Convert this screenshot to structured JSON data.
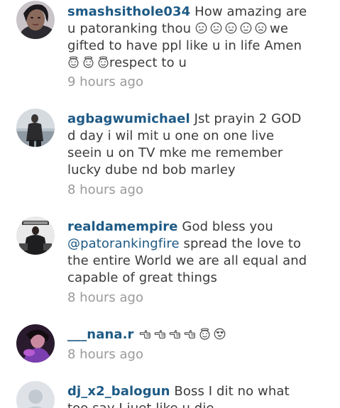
{
  "comments": [
    {
      "username": "smashsithole034",
      "text_1": "How amazing are u patoranking thou",
      "text_2": "we gifted to have ppl like u in life Amen",
      "text_3": "respect to u",
      "time": "9 hours ago"
    },
    {
      "username": "agbagwumichael",
      "text": "Jst prayin 2 GOD d day i wil mit u one on one live seein u on TV mke me remember lucky dube nd bob marley",
      "time": "8 hours ago"
    },
    {
      "username": "realdamempire",
      "text_1": "God bless you",
      "mention": "@patorankingfire",
      "text_2": "spread the love to the entire World we are all equal and capable of great things",
      "time": "8 hours ago"
    },
    {
      "username": "___nana.r",
      "time": "8 hours ago"
    },
    {
      "username": "dj_x2_balogun",
      "text": "Boss I dit no what  too say I juet like u die",
      "time": ""
    }
  ],
  "icons": {
    "unamused": "unamused-face-icon",
    "expressionless": "expressionless-face-icon",
    "neutral": "neutral-face-icon",
    "confused": "confused-face-icon",
    "angel": "smiling-face-with-halo-icon",
    "point_left": "backhand-index-pointing-left-icon",
    "heart_eyes": "smiling-face-with-heart-eyes-icon"
  },
  "colors": {
    "username": "#1e5a85",
    "text": "#3b3b3b",
    "timestamp": "#9a9a9a"
  }
}
